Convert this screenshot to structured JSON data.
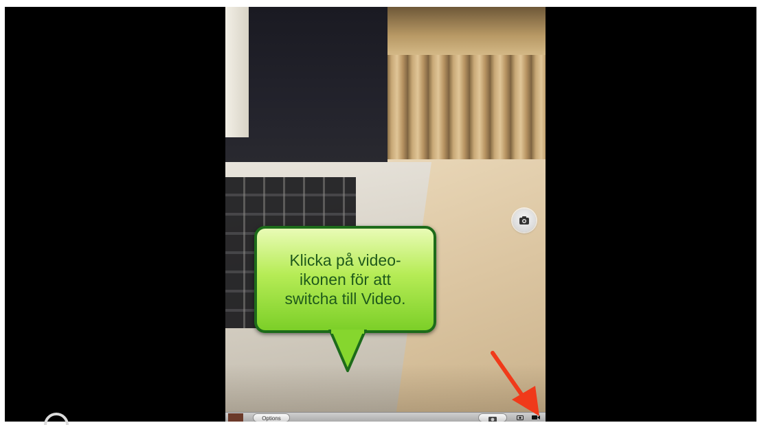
{
  "video": {
    "annotation_text": "Klicka på video-\nikonen för att\nswitcha till Video.",
    "annotation_color": "#7ccf28",
    "annotation_border": "#1d6b1a",
    "arrow_color": "#f03a1a"
  },
  "camera_ui": {
    "options_label": "Options",
    "camera_switch_icon": "camera-flip-icon",
    "shutter_icon": "camera-icon",
    "photo_mode_icon": "camera-mode-icon",
    "video_mode_icon": "video-mode-icon"
  }
}
